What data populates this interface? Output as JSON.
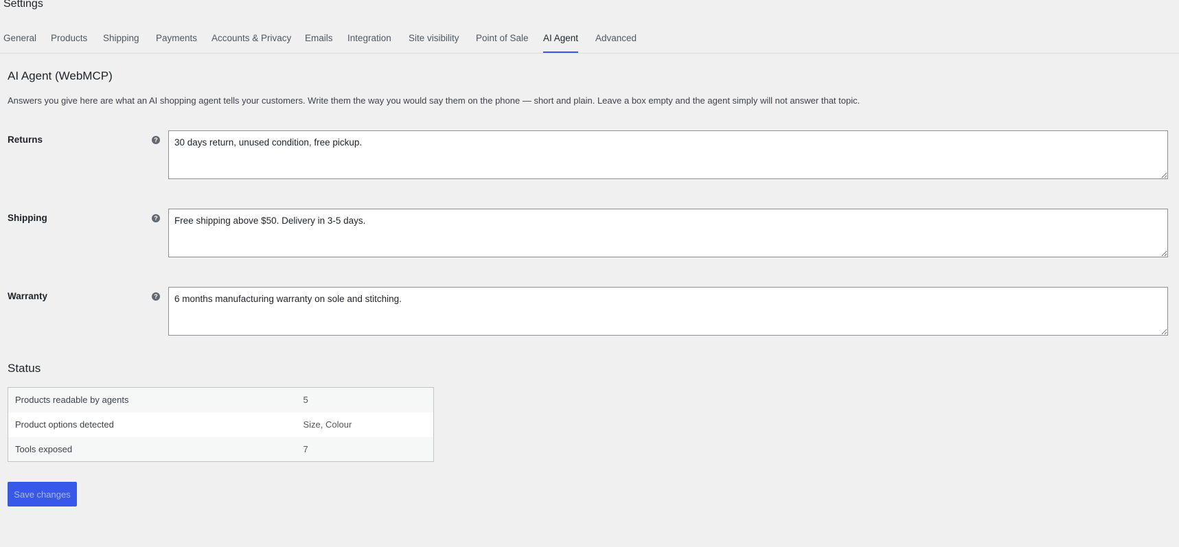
{
  "header": {
    "title": "Settings"
  },
  "tabs": [
    {
      "label": "General"
    },
    {
      "label": "Products"
    },
    {
      "label": "Shipping"
    },
    {
      "label": "Payments"
    },
    {
      "label": "Accounts & Privacy"
    },
    {
      "label": "Emails"
    },
    {
      "label": "Integration"
    },
    {
      "label": "Site visibility"
    },
    {
      "label": "Point of Sale"
    },
    {
      "label": "AI Agent",
      "active": true
    },
    {
      "label": "Advanced"
    }
  ],
  "section": {
    "title": "AI Agent (WebMCP)",
    "description": "Answers you give here are what an AI shopping agent tells your customers. Write them the way you would say them on the phone — short and plain. Leave a box empty and the agent simply will not answer that topic."
  },
  "fields": [
    {
      "label": "Returns",
      "value": "30 days return, unused condition, free pickup."
    },
    {
      "label": "Shipping",
      "value": "Free shipping above $50. Delivery in 3-5 days."
    },
    {
      "label": "Warranty",
      "value": "6 months manufacturing warranty on sole and stitching."
    }
  ],
  "help_icon": {
    "glyph": "?",
    "icon": "help-circle-icon"
  },
  "status": {
    "title": "Status",
    "rows": [
      {
        "label": "Products readable by agents",
        "value": "5"
      },
      {
        "label": "Product options detected",
        "value": "Size, Colour"
      },
      {
        "label": "Tools exposed",
        "value": "7"
      }
    ]
  },
  "actions": {
    "save_label": "Save changes"
  },
  "colors": {
    "accent": "#3858e9",
    "background": "#f0f0f1"
  }
}
